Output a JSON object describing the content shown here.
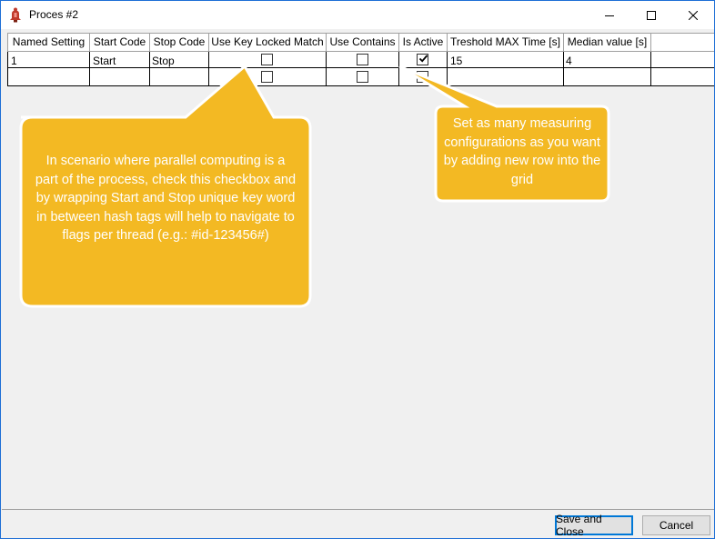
{
  "window": {
    "title": "Proces #2",
    "accent_color": "#1e6fd6",
    "icons": {
      "app": "bell-icon",
      "minimize": "minimize-icon",
      "maximize": "maximize-icon",
      "close": "close-icon"
    }
  },
  "grid": {
    "columns": [
      "Named Setting",
      "Start Code",
      "Stop Code",
      "Use Key Locked Match",
      "Use Contains",
      "Is Active",
      "Treshold MAX Time [s]",
      "Median value [s]"
    ],
    "rows": [
      {
        "named_setting": "1",
        "start_code": "Start",
        "stop_code": "Stop",
        "use_key_locked_match": false,
        "use_contains": false,
        "is_active": true,
        "threshold": "15",
        "median": "4"
      },
      {
        "named_setting": "",
        "start_code": "",
        "stop_code": "",
        "use_key_locked_match": false,
        "use_contains": false,
        "is_active": false,
        "threshold": "",
        "median": ""
      }
    ]
  },
  "callouts": {
    "color": "#f3b923",
    "left_text": "In scenario where parallel computing is a part of the process, check this checkbox and by wrapping Start and Stop unique key word in between hash tags will help to navigate to flags per thread (e.g.: #id-123456#)",
    "right_text": "Set as many measuring configurations as you want by adding new row into the grid"
  },
  "footer": {
    "save_label": "Save and Close",
    "cancel_label": "Cancel"
  }
}
